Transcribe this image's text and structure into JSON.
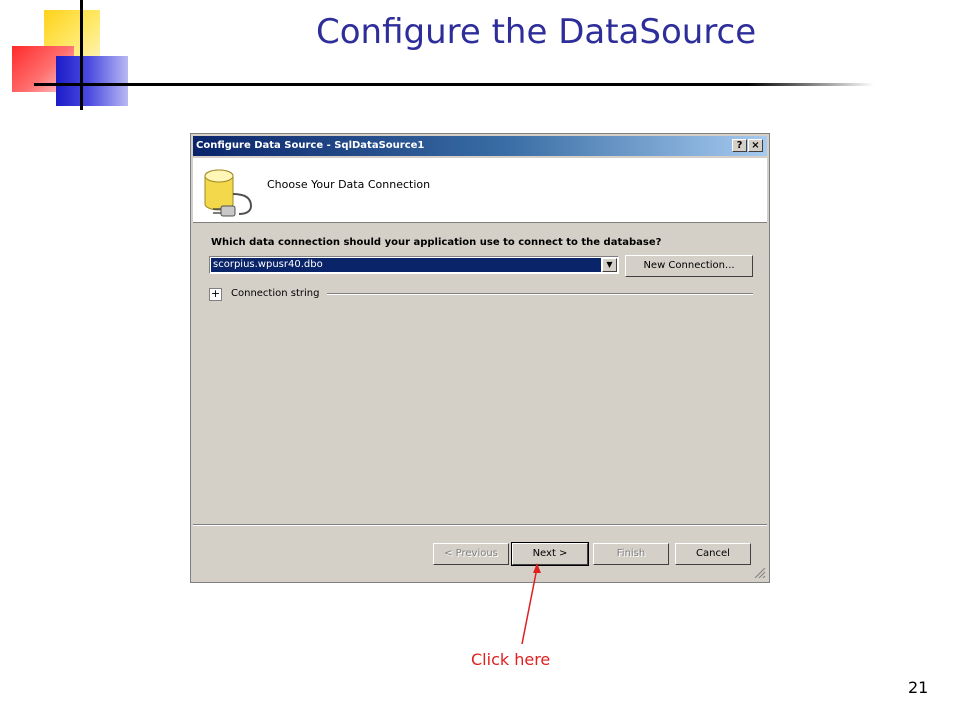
{
  "slide": {
    "title": "Configure the DataSource",
    "page_number": "21",
    "annotation": "Click here"
  },
  "dialog": {
    "title": "Configure Data Source - SqlDataSource1",
    "help_button": "?",
    "close_button": "×",
    "header_title": "Choose Your Data Connection",
    "question": "Which data connection should your application use to connect to the database?",
    "connection_selected": "scorpius.wpusr40.dbo",
    "new_connection_button": "New Connection...",
    "expand_symbol": "+",
    "connection_string_label": "Connection string",
    "buttons": {
      "previous": "< Previous",
      "next": "Next >",
      "finish": "Finish",
      "cancel": "Cancel"
    }
  },
  "colors": {
    "title_text": "#2e2e9a",
    "annotation": "#e02020",
    "titlebar_start": "#0a246a",
    "titlebar_end": "#a6caf0",
    "dialog_face": "#d4d0c8"
  },
  "icons": [
    "database-icon",
    "help-icon",
    "close-icon",
    "dropdown-arrow-icon",
    "expand-icon",
    "resize-grip-icon",
    "arrow-icon"
  ]
}
